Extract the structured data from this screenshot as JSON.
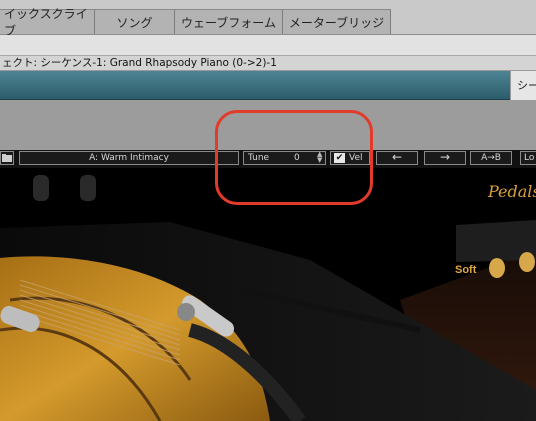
{
  "tabs": [
    {
      "label": "イックスクライブ"
    },
    {
      "label": "ソング"
    },
    {
      "label": "ウェーブフォーム"
    },
    {
      "label": "メーターブリッジ"
    }
  ],
  "title_text": "ェクト: シーケンス-1: Grand Rhapsody Piano (0->2)-1",
  "side_button_label": "シー",
  "toolbar": {
    "preset_label": "A: Warm Intimacy",
    "tune_label": "Tune",
    "tune_value": "0",
    "vel_label": "Vel",
    "vel_checked": true,
    "prev_arrow": "←",
    "next_arrow": "→",
    "ab_label": "A→B",
    "lo_label": "Lo"
  },
  "pedals": {
    "title": "Pedals",
    "soft_label": "Soft"
  },
  "colors": {
    "highlight": "#e23b2b",
    "teal_header": "#3d7383",
    "gold": "#d9a13c"
  },
  "icons": {
    "folder": "folder-icon",
    "checkbox": "checkmark-icon",
    "spinner": "spinner-arrows-icon"
  }
}
